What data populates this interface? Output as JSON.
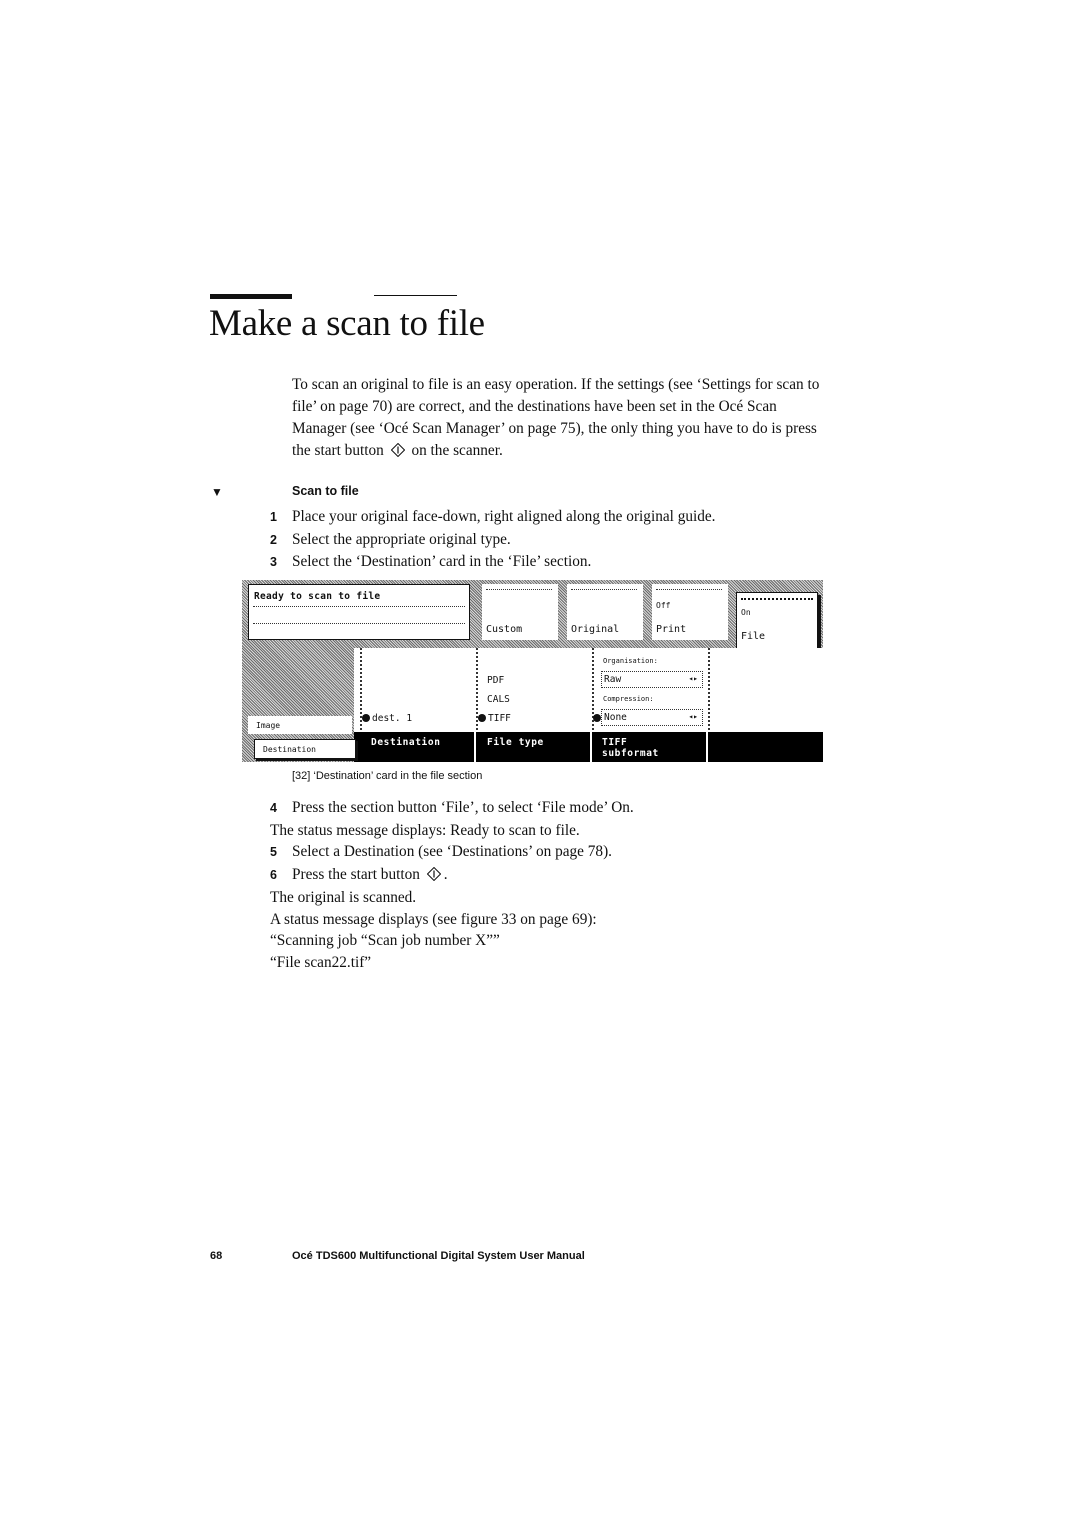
{
  "page": {
    "title": "Make a scan to file",
    "intro_before_glyph": "To scan an original to file is an easy operation. If the settings (see ‘Settings for scan to file’ on page 70) are correct, and the destinations have been set in the Océ Scan Manager (see ‘Océ Scan Manager’ on page 75), the only thing you have to do is press the start button",
    "intro_after_glyph": "on the scanner.",
    "procedure_marker": "▼",
    "procedure_title": "Scan to file",
    "steps_before_figure": [
      {
        "num": "1",
        "text": "Place your original face-down, right aligned along the original guide."
      },
      {
        "num": "2",
        "text": "Select the appropriate original type."
      },
      {
        "num": "3",
        "text": "Select the ‘Destination’ card in the ‘File’ section."
      }
    ],
    "figure_caption": "[32] ‘Destination’ card in the file section",
    "step4": {
      "num": "4",
      "text": "Press the section button ‘File’, to select ‘File mode’ On.",
      "cont": "The status message displays: Ready to scan to file."
    },
    "step5": {
      "num": "5",
      "text": "Select a Destination (see ‘Destinations’ on page 78)."
    },
    "step6": {
      "num": "6",
      "text_before_glyph": "Press the start button",
      "text_after_glyph": ".",
      "cont": [
        "The original is scanned.",
        "A status message displays (see figure 33 on page 69):",
        "“Scanning job “Scan job number X””",
        "“File scan22.tif”"
      ]
    },
    "footer": {
      "page_number": "68",
      "manual_title": "Océ TDS600 Multifunctional Digital System User Manual"
    }
  },
  "panel": {
    "status_message": "Ready to scan to file",
    "section_cards": [
      {
        "label": "Custom",
        "value": ""
      },
      {
        "label": "Original",
        "value": ""
      },
      {
        "label": "Print",
        "value": "Off"
      },
      {
        "label": "File",
        "value": "On"
      }
    ],
    "side_tabs": [
      "Image",
      "Destination"
    ],
    "destination": {
      "selected": "dest. 1"
    },
    "file_type": {
      "options": [
        "PDF",
        "CALS",
        "TIFF"
      ],
      "selected": "TIFF"
    },
    "tiff_subformat": {
      "organisation_label": "Organisation:",
      "organisation_value": "Raw",
      "compression_label": "Compression:",
      "compression_value": "None"
    },
    "card_tabs": [
      "Destination",
      "File type",
      "TIFF",
      "subformat"
    ]
  }
}
